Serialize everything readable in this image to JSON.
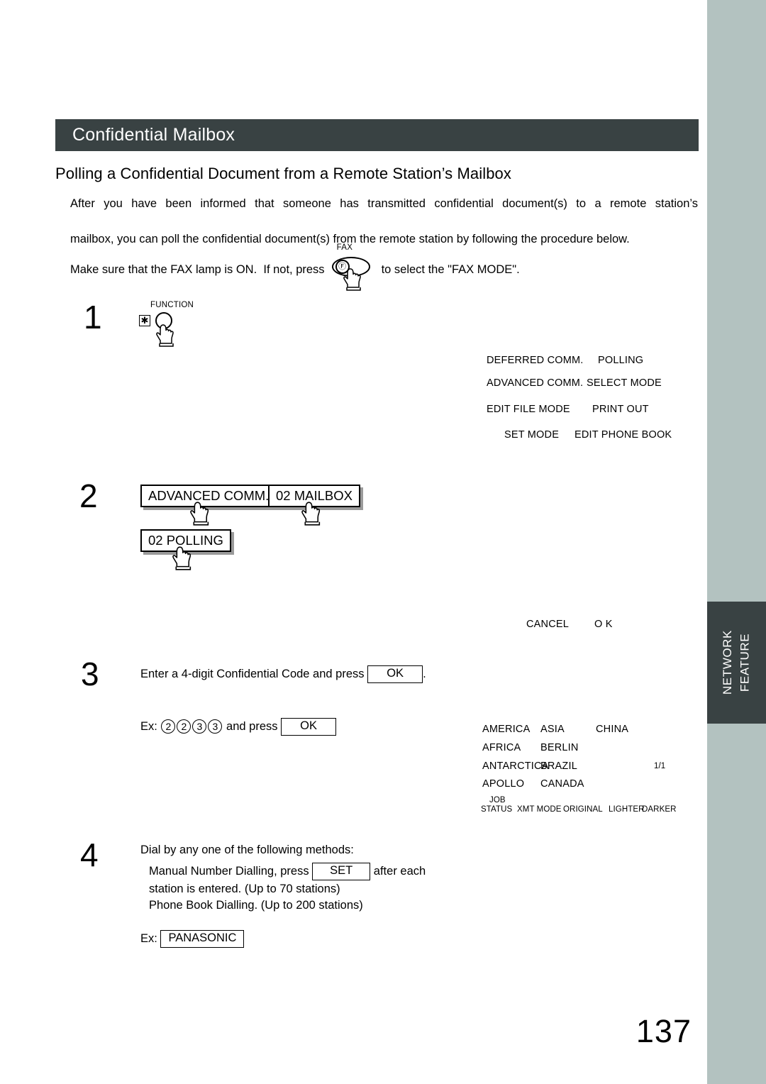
{
  "document": {
    "section_title": "Confidential Mailbox",
    "subheading": "Polling a Confidential Document from a Remote Station’s Mailbox",
    "intro_line1": "After you have been informed that someone has transmitted confidential document(s) to a remote station’s",
    "intro_line2": "mailbox, you can poll the confidential document(s) from the remote station by following the procedure below.",
    "fax_note_prefix": "Make sure that the FAX lamp is ON.  If not, press",
    "fax_note_suffix": "to select the \"FAX MODE\".",
    "page_number": "137"
  },
  "side_tab": {
    "label": "NETWORK\nFEATURE"
  },
  "keys": {
    "fax_key_label": "FAX",
    "fax_key_glyph": "Ⓕ",
    "function_key_label": "FUNCTION",
    "asterisk_glyph": "✱"
  },
  "steps": [
    {
      "number": "1",
      "display_rows": [
        {
          "left": "DEFERRED COMM.",
          "right": "POLLING"
        },
        {
          "left": "ADVANCED COMM.",
          "right": "SELECT MODE"
        },
        {
          "left": "EDIT FILE MODE",
          "right": "PRINT OUT"
        },
        {
          "left": "SET MODE",
          "right": "EDIT PHONE BOOK"
        }
      ]
    },
    {
      "number": "2",
      "buttons": [
        {
          "label": "ADVANCED COMM."
        },
        {
          "label": "02 MAILBOX"
        },
        {
          "label": "02 POLLING"
        }
      ],
      "softkeys": {
        "cancel": "CANCEL",
        "ok": "O K"
      }
    },
    {
      "number": "3",
      "instruction_before": "Enter a 4-digit Confidential Code and press",
      "instruction_key": "OK",
      "instruction_after": ".",
      "example_prefix": "Ex:",
      "example_digits": [
        "2",
        "2",
        "3",
        "3"
      ],
      "example_middle": "and press",
      "example_key": "OK"
    },
    {
      "number": "4",
      "line1": "Dial by any one of the following methods:",
      "line2_before": "Manual Number Dialling, press",
      "line2_key": "SET",
      "line2_after": "after each",
      "line3": "station is entered. (Up to 70 stations)",
      "line4": "Phone Book Dialling. (Up to 200 stations)",
      "example_prefix": "Ex:",
      "example_key": "PANASONIC"
    }
  ],
  "phonebook_display": {
    "rows": [
      [
        "AMERICA",
        "ASIA",
        "CHINA"
      ],
      [
        "AFRICA",
        "BERLIN",
        ""
      ],
      [
        "ANTARCTICA",
        "BRAZIL",
        ""
      ],
      [
        "APOLLO",
        "CANADA",
        ""
      ]
    ],
    "page_indicator": "1/1",
    "softkeys": [
      "JOB",
      "STATUS",
      "XMT MODE",
      "ORIGINAL",
      "LIGHTER",
      "DARKER"
    ]
  },
  "colors": {
    "header_bar": "#394243",
    "side_strip": "#b3c2c0",
    "tab": "#394243"
  }
}
